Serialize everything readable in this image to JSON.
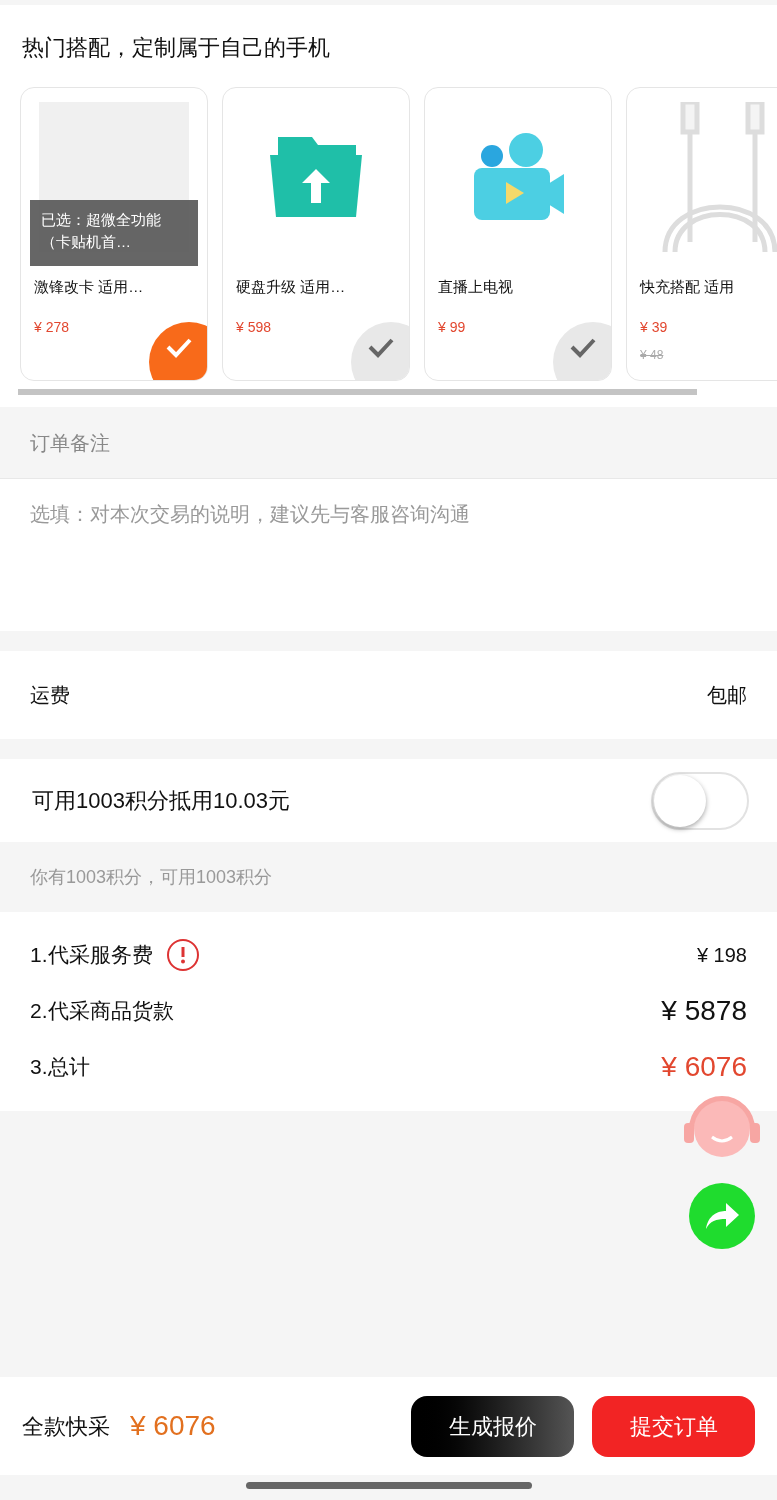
{
  "section_title": "热门搭配，定制属于自己的手机",
  "products": [
    {
      "kind": "logo-photo",
      "overlay": "已选：超微全功能（卡贴机首…",
      "title": "激锋改卡 适用…",
      "price": "¥ 278",
      "selected": true
    },
    {
      "kind": "folder-upload",
      "title": "硬盘升级 适用…",
      "price": "¥ 598",
      "selected": false
    },
    {
      "kind": "video-camera",
      "title": "直播上电视",
      "price": "¥ 99",
      "selected": false
    },
    {
      "kind": "cable-photo",
      "title": "快充搭配 适用",
      "price": "¥ 39",
      "original_price": "¥ 48"
    }
  ],
  "remark": {
    "label": "订单备注",
    "placeholder": "选填：对本次交易的说明，建议先与客服咨询沟通"
  },
  "shipping": {
    "label": "运费",
    "value": "包邮"
  },
  "points": {
    "label": "可用1003积分抵用10.03元",
    "on": false,
    "hint": "你有1003积分，可用1003积分"
  },
  "fees": [
    {
      "label": "1.代采服务费",
      "info": true,
      "value": "¥ 198",
      "kind": "small"
    },
    {
      "label": "2.代采商品货款",
      "info": false,
      "value": "¥ 5878",
      "kind": "large"
    },
    {
      "label": "3.总计",
      "info": false,
      "value": "¥ 6076",
      "kind": "total"
    }
  ],
  "footer": {
    "label": "全款快采",
    "total": "¥ 6076",
    "buttons": [
      "生成报价",
      "提交订单"
    ]
  }
}
